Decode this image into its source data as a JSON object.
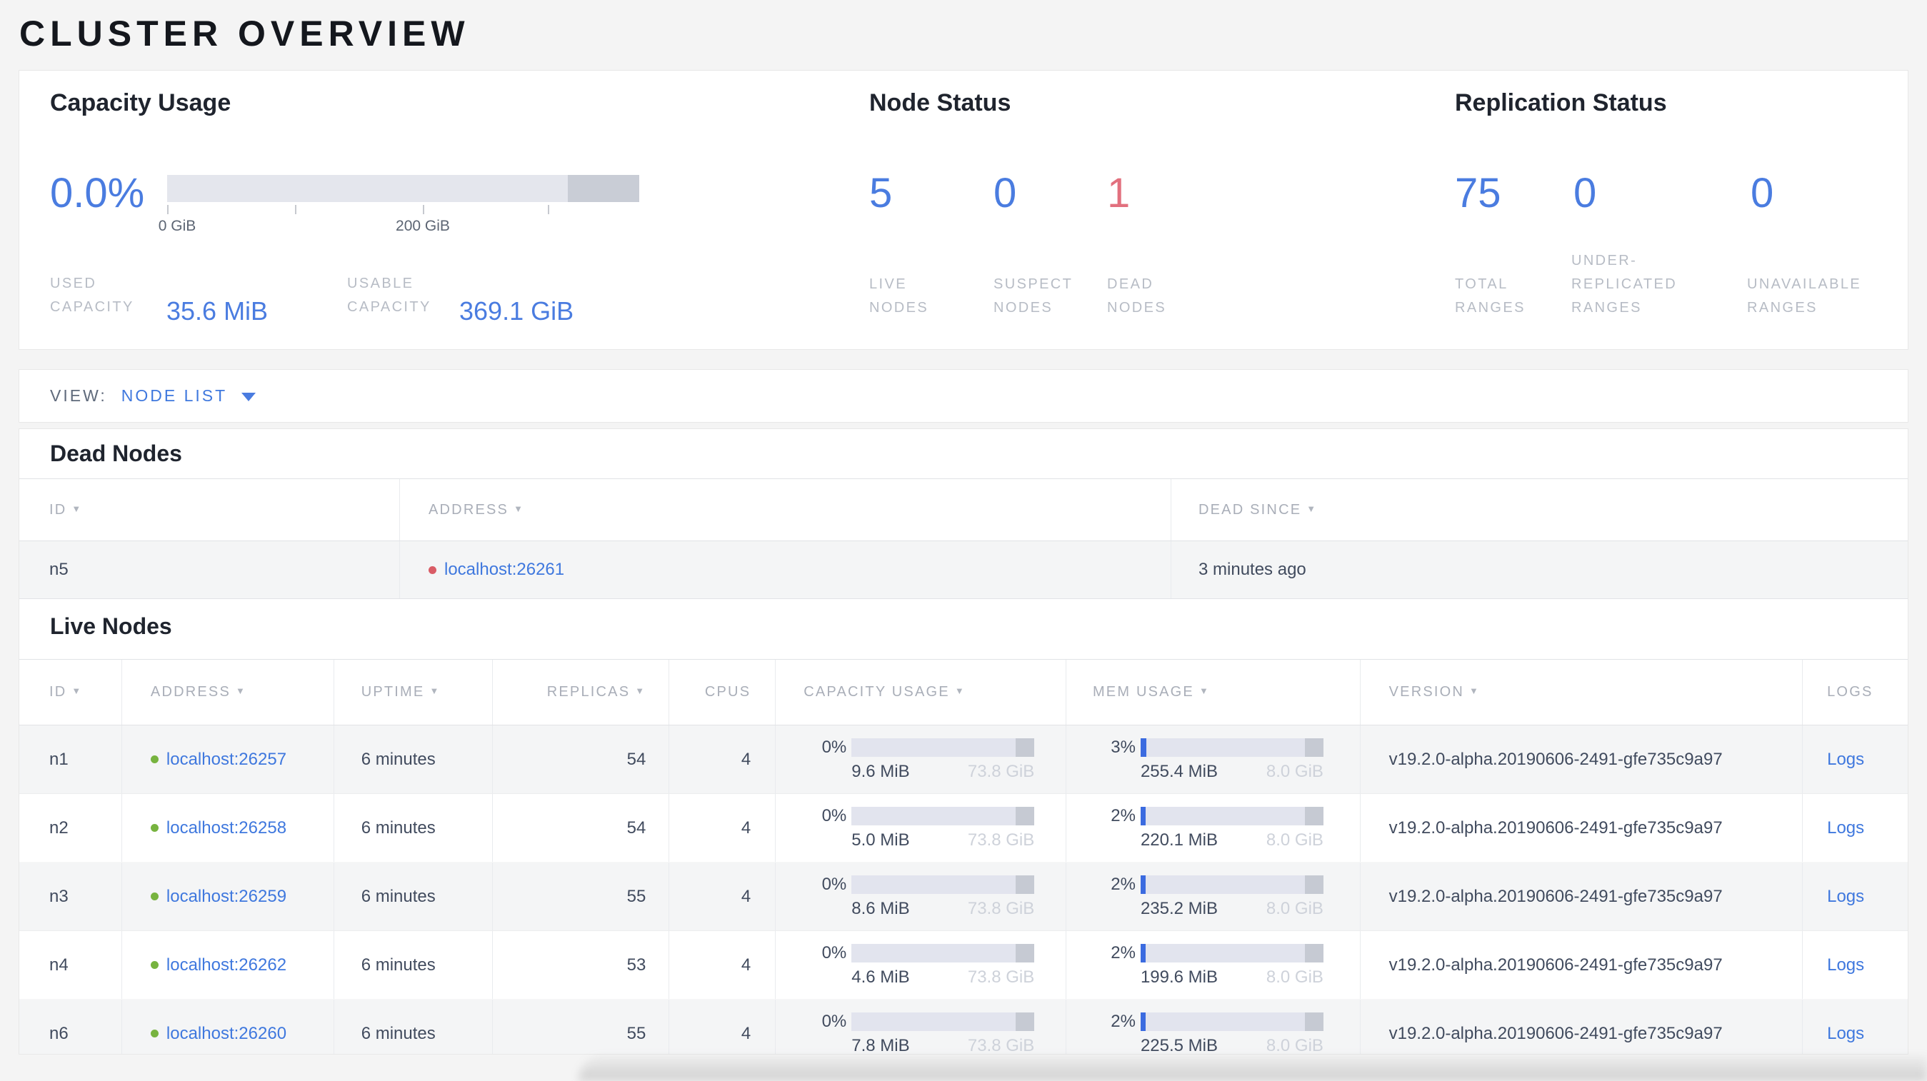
{
  "page_title": "CLUSTER OVERVIEW",
  "colors": {
    "accent_blue": "#4a7ce0",
    "dead_red": "#e2707e",
    "live_dot_green": "#77b33f",
    "dead_dot_red": "#d95c66",
    "link_blue": "#3f78de",
    "bar_fill_blue": "#3b6be0"
  },
  "summary": {
    "capacity": {
      "title": "Capacity Usage",
      "percent": "0.0%",
      "tick_0": "0 GiB",
      "tick_200": "200 GiB",
      "used_label": "USED\nCAPACITY",
      "used_value": "35.6 MiB",
      "usable_label": "USABLE\nCAPACITY",
      "usable_value": "369.1 GiB"
    },
    "node_status": {
      "title": "Node Status",
      "live": {
        "value": "5",
        "label": "LIVE\nNODES"
      },
      "suspect": {
        "value": "0",
        "label": "SUSPECT\nNODES"
      },
      "dead": {
        "value": "1",
        "label": "DEAD\nNODES"
      }
    },
    "replication": {
      "title": "Replication Status",
      "total": {
        "value": "75",
        "label": "TOTAL\nRANGES"
      },
      "under": {
        "value": "0",
        "label": "UNDER-\nREPLICATED\nRANGES"
      },
      "unavailable": {
        "value": "0",
        "label": "UNAVAILABLE\nRANGES"
      }
    }
  },
  "view_bar": {
    "label": "VIEW:",
    "selected": "NODE LIST"
  },
  "dead_nodes": {
    "heading": "Dead Nodes",
    "headers": {
      "id": "ID",
      "address": "ADDRESS",
      "dead_since": "DEAD SINCE"
    },
    "rows": [
      {
        "id": "n5",
        "address": "localhost:26261",
        "dead_since": "3 minutes ago"
      }
    ]
  },
  "live_nodes": {
    "heading": "Live Nodes",
    "logs_label": "Logs",
    "headers": {
      "id": "ID",
      "address": "ADDRESS",
      "uptime": "UPTIME",
      "replicas": "REPLICAS",
      "cpus": "CPUS",
      "capacity": "CAPACITY USAGE",
      "mem": "MEM USAGE",
      "version": "VERSION",
      "logs": "LOGS"
    },
    "rows": [
      {
        "id": "n1",
        "address": "localhost:26257",
        "uptime": "6 minutes",
        "replicas": "54",
        "cpus": "4",
        "cap_pct": "0%",
        "cap_used": "9.6 MiB",
        "cap_total": "73.8 GiB",
        "mem_pct": "3%",
        "mem_used": "255.4 MiB",
        "mem_total": "8.0 GiB",
        "version": "v19.2.0-alpha.20190606-2491-gfe735c9a97"
      },
      {
        "id": "n2",
        "address": "localhost:26258",
        "uptime": "6 minutes",
        "replicas": "54",
        "cpus": "4",
        "cap_pct": "0%",
        "cap_used": "5.0 MiB",
        "cap_total": "73.8 GiB",
        "mem_pct": "2%",
        "mem_used": "220.1 MiB",
        "mem_total": "8.0 GiB",
        "version": "v19.2.0-alpha.20190606-2491-gfe735c9a97"
      },
      {
        "id": "n3",
        "address": "localhost:26259",
        "uptime": "6 minutes",
        "replicas": "55",
        "cpus": "4",
        "cap_pct": "0%",
        "cap_used": "8.6 MiB",
        "cap_total": "73.8 GiB",
        "mem_pct": "2%",
        "mem_used": "235.2 MiB",
        "mem_total": "8.0 GiB",
        "version": "v19.2.0-alpha.20190606-2491-gfe735c9a97"
      },
      {
        "id": "n4",
        "address": "localhost:26262",
        "uptime": "6 minutes",
        "replicas": "53",
        "cpus": "4",
        "cap_pct": "0%",
        "cap_used": "4.6 MiB",
        "cap_total": "73.8 GiB",
        "mem_pct": "2%",
        "mem_used": "199.6 MiB",
        "mem_total": "8.0 GiB",
        "version": "v19.2.0-alpha.20190606-2491-gfe735c9a97"
      },
      {
        "id": "n6",
        "address": "localhost:26260",
        "uptime": "6 minutes",
        "replicas": "55",
        "cpus": "4",
        "cap_pct": "0%",
        "cap_used": "7.8 MiB",
        "cap_total": "73.8 GiB",
        "mem_pct": "2%",
        "mem_used": "225.5 MiB",
        "mem_total": "8.0 GiB",
        "version": "v19.2.0-alpha.20190606-2491-gfe735c9a97"
      }
    ]
  }
}
